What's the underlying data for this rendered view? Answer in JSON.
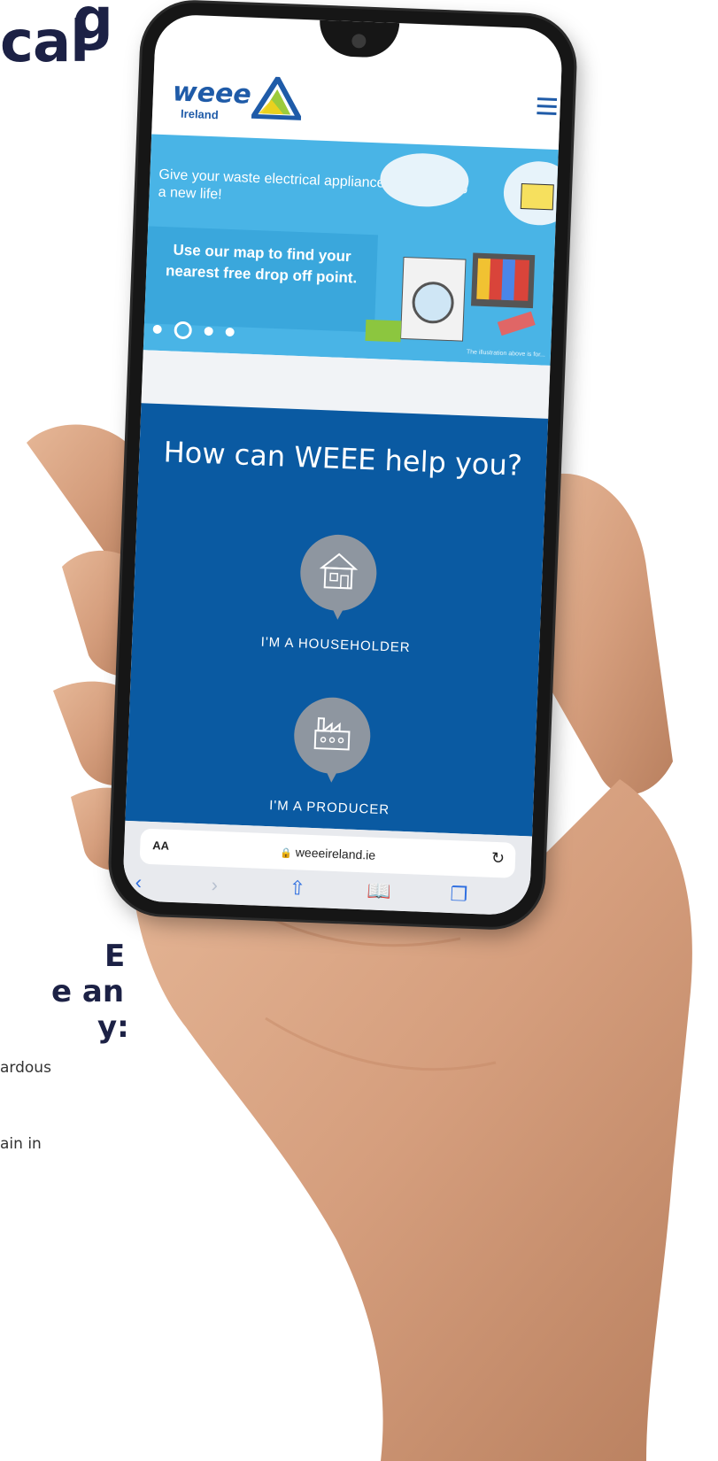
{
  "background": {
    "heading_line_1": "g",
    "heading_line_2": "cal",
    "side_heading_lines": [
      "E",
      "e an",
      "y:"
    ],
    "copy_1": "ardous",
    "copy_2": "ain in"
  },
  "site": {
    "logo_word": "weee",
    "logo_sub": "Ireland",
    "menu_icon": "hamburger-icon",
    "hero": {
      "text": "Give your waste electrical appliances and lighting a new life!",
      "cta": "Use our map to find your nearest free drop off point.",
      "slides": 4,
      "active_slide": 2,
      "credit": "The illustration above is for..."
    },
    "help": {
      "title": "How can WEEE help you?",
      "items": [
        {
          "label": "I'M A HOUSEHOLDER",
          "icon": "house-icon"
        },
        {
          "label": "I'M A PRODUCER",
          "icon": "factory-icon"
        }
      ]
    }
  },
  "browser": {
    "aa_label": "AA",
    "url": "weeeireland.ie",
    "reload_icon": "reload-icon",
    "toolbar": [
      "back-icon",
      "forward-icon",
      "share-icon",
      "bookmarks-icon",
      "tabs-icon"
    ]
  },
  "colors": {
    "brand_blue": "#1f5ba8",
    "hero_blue": "#49b4e6",
    "help_blue": "#0a5aa2",
    "accent_green": "#9ccb3b"
  }
}
